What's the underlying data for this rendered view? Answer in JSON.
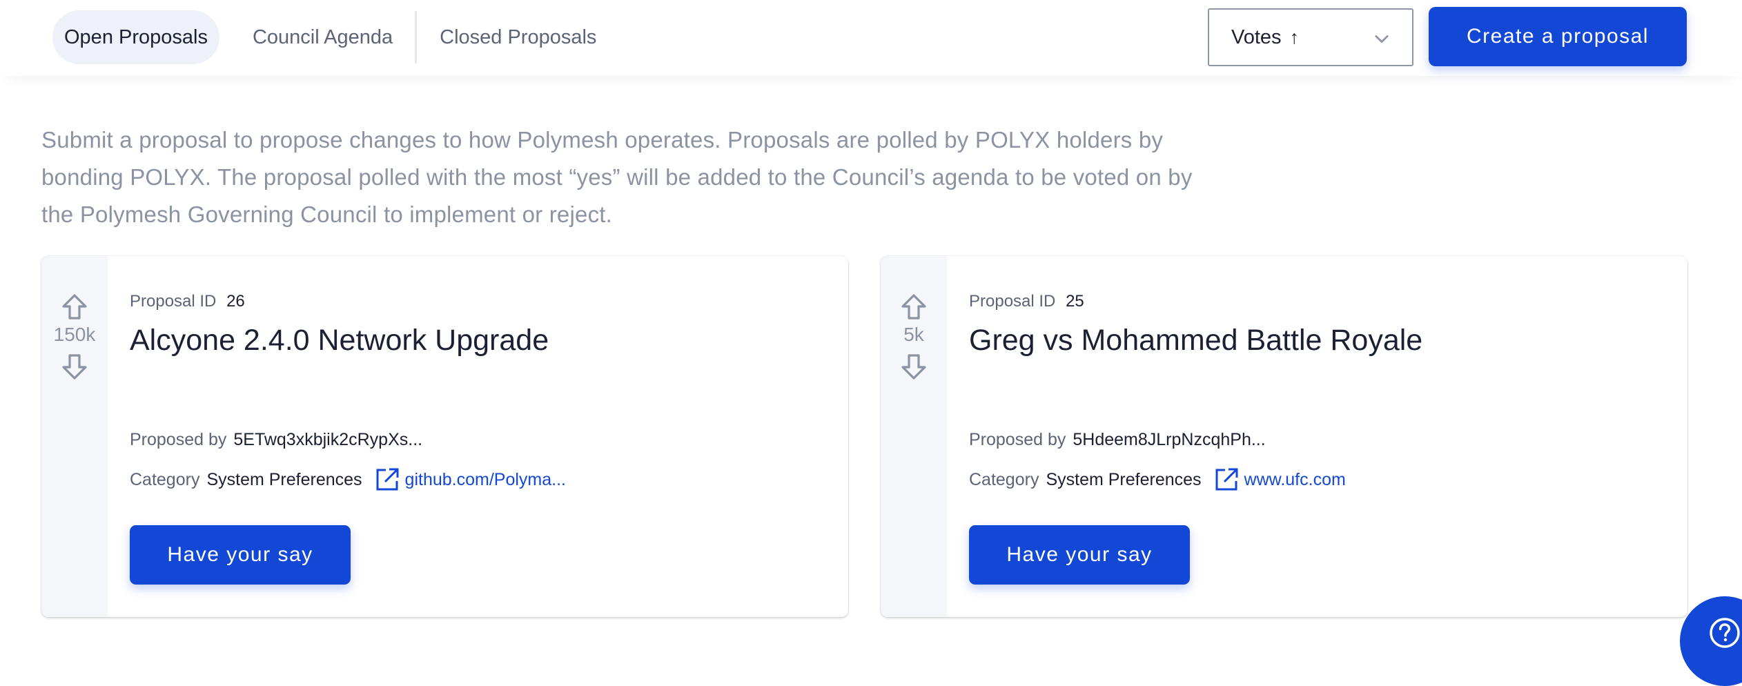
{
  "tabs": {
    "open": "Open Proposals",
    "council": "Council Agenda",
    "closed": "Closed Proposals"
  },
  "sort": {
    "label": "Votes",
    "direction_glyph": "↑"
  },
  "create_button": "Create a proposal",
  "intro_text": "Submit a proposal to propose changes to how Polymesh operates. Proposals are polled by POLYX holders by bonding POLYX. The proposal polled with the most “yes” will be added to the Council’s agenda to be voted on by the Polymesh Governing Council to implement or reject.",
  "labels": {
    "proposal_id": "Proposal ID",
    "proposed_by": "Proposed by",
    "category": "Category",
    "have_your_say": "Have your say"
  },
  "proposals": [
    {
      "votes": "150k",
      "id": "26",
      "title": "Alcyone 2.4.0 Network Upgrade",
      "proposer": "5ETwq3xkbjik2cRypXs...",
      "category": "System Preferences",
      "link": "github.com/Polyma..."
    },
    {
      "votes": "5k",
      "id": "25",
      "title": "Greg vs Mohammed Battle Royale",
      "proposer": "5Hdeem8JLrpNzcqhPh...",
      "category": "System Preferences",
      "link": "www.ufc.com"
    }
  ],
  "icons": {
    "vote_up": "arrow-up-outline-icon",
    "vote_down": "arrow-down-outline-icon",
    "external_link": "external-link-icon",
    "dropdown": "chevron-down-icon",
    "help": "question-mark-icon"
  },
  "colors": {
    "accent": "#1348d6",
    "muted_text": "#8b93a3",
    "active_tab_bg": "#eef1f8"
  }
}
